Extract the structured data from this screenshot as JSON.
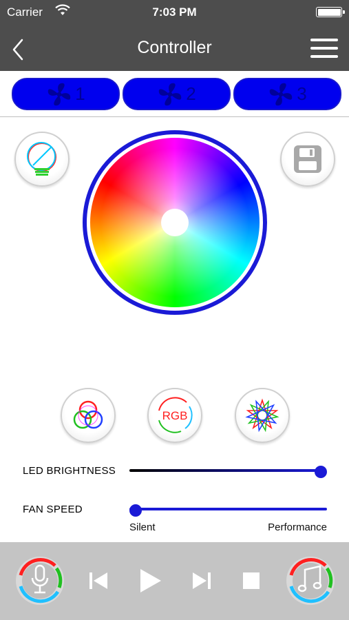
{
  "status_bar": {
    "carrier": "Carrier",
    "time": "7:03 PM"
  },
  "header": {
    "title": "Controller",
    "back_icon": "chevron-left-icon",
    "menu_icon": "hamburger-menu-icon"
  },
  "fan_tabs": [
    {
      "label": "1",
      "icon": "fan-icon"
    },
    {
      "label": "2",
      "icon": "fan-icon"
    },
    {
      "label": "3",
      "icon": "fan-icon"
    }
  ],
  "side_buttons": {
    "left_icon": "bulb-icon",
    "right_icon": "floppy-save-icon"
  },
  "mode_buttons": [
    {
      "icon": "rgb-circles-icon"
    },
    {
      "icon": "rgb-cycle-icon",
      "text": "RGB"
    },
    {
      "icon": "star-pattern-icon"
    }
  ],
  "sliders": {
    "led_brightness": {
      "label": "LED  BRIGHTNESS",
      "value": 1.0
    },
    "fan_speed": {
      "label": "FAN SPEED",
      "value": 0.0,
      "min_label": "Silent",
      "max_label": "Performance"
    }
  },
  "player": {
    "left_icon": "microphone-icon",
    "controls": [
      "previous-icon",
      "play-icon",
      "next-icon",
      "stop-icon"
    ],
    "right_icon": "music-note-icon"
  },
  "colors": {
    "accent": "#1a1ad6",
    "tab_fill": "#0000ee",
    "topbar": "#4d4d4d",
    "player_bar": "#c4c4c4"
  }
}
